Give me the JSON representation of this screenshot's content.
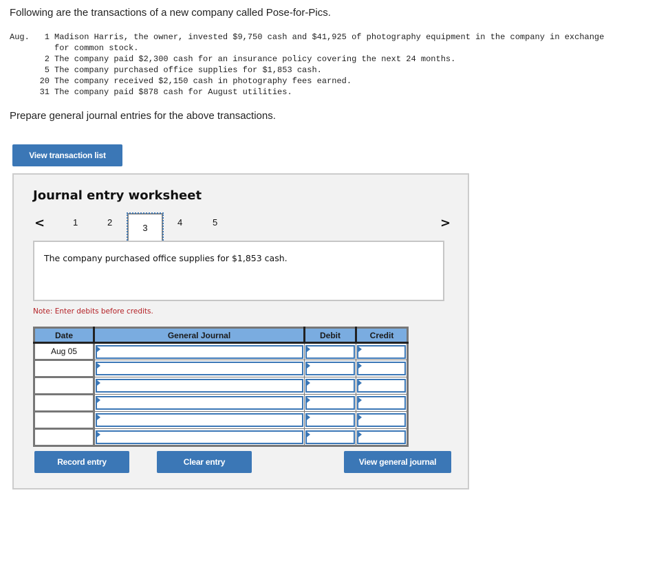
{
  "intro": "Following are the transactions of a new company called Pose-for-Pics.",
  "transactions": {
    "month": "Aug.",
    "items": [
      {
        "day": "1",
        "text": "Madison Harris, the owner, invested $9,750 cash and $41,925 of photography equipment in the company in exchange",
        "cont": "for common stock."
      },
      {
        "day": "2",
        "text": "The company paid $2,300 cash for an insurance policy covering the next 24 months."
      },
      {
        "day": "5",
        "text": "The company purchased office supplies for $1,853 cash."
      },
      {
        "day": "20",
        "text": "The company received $2,150 cash in photography fees earned."
      },
      {
        "day": "31",
        "text": "The company paid $878 cash for August utilities."
      }
    ]
  },
  "prompt": "Prepare general journal entries for the above transactions.",
  "buttons": {
    "view_transaction_list": "View transaction list",
    "record_entry": "Record entry",
    "clear_entry": "Clear entry",
    "view_general_journal": "View general journal"
  },
  "worksheet": {
    "title": "Journal entry worksheet",
    "nav_prev": "<",
    "nav_next": ">",
    "pages": [
      "1",
      "2",
      "3",
      "4",
      "5"
    ],
    "current_page": "3",
    "description": "The company purchased office supplies for $1,853 cash.",
    "note": "Note: Enter debits before credits."
  },
  "journal_table": {
    "headers": {
      "date": "Date",
      "general_journal": "General Journal",
      "debit": "Debit",
      "credit": "Credit"
    },
    "rows": [
      {
        "date": "Aug 05",
        "account": "",
        "debit": "",
        "credit": ""
      },
      {
        "date": "",
        "account": "",
        "debit": "",
        "credit": ""
      },
      {
        "date": "",
        "account": "",
        "debit": "",
        "credit": ""
      },
      {
        "date": "",
        "account": "",
        "debit": "",
        "credit": ""
      },
      {
        "date": "",
        "account": "",
        "debit": "",
        "credit": ""
      },
      {
        "date": "",
        "account": "",
        "debit": "",
        "credit": ""
      }
    ]
  },
  "colors": {
    "accent": "#3b77b6",
    "header_blue": "#7aace0",
    "note_red": "#b32025",
    "panel_bg": "#f2f2f2"
  }
}
